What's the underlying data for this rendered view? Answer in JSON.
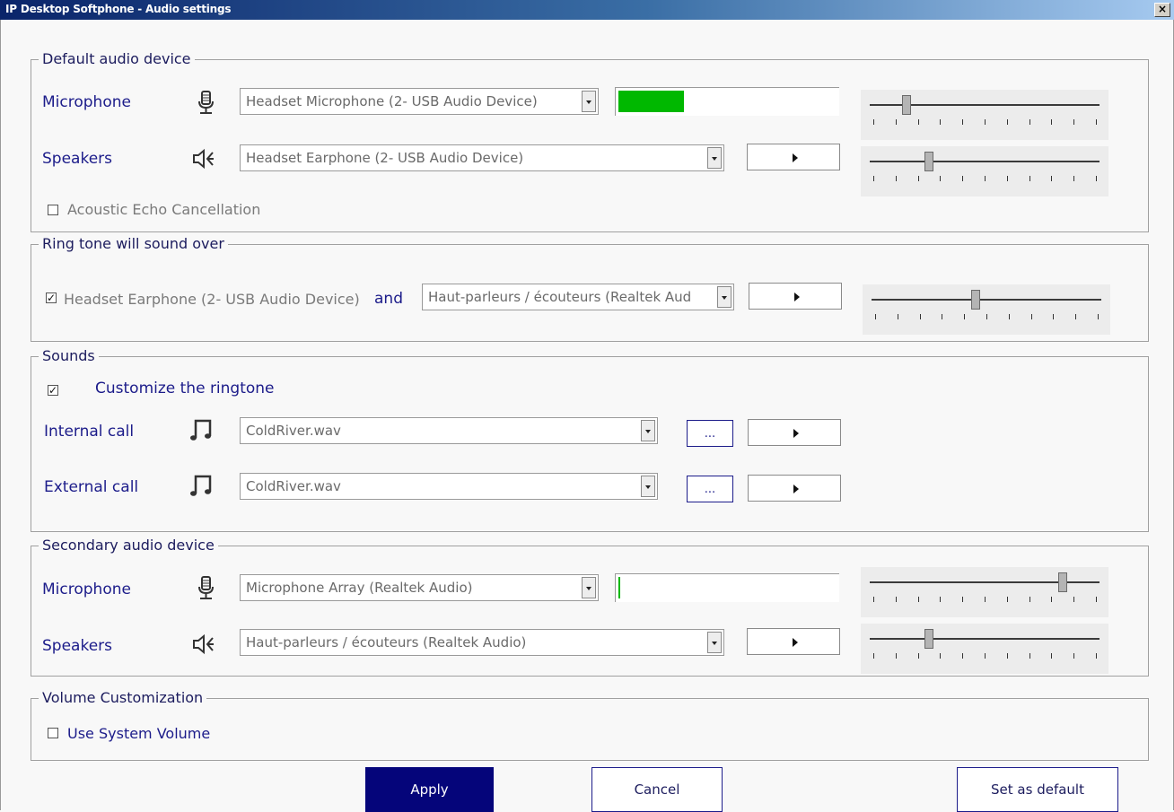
{
  "window": {
    "title": "IP Desktop Softphone - Audio settings",
    "close_label": "×"
  },
  "default_device": {
    "legend": "Default audio device",
    "microphone_label": "Microphone",
    "microphone_value": "Headset Microphone (2- USB Audio Device)",
    "microphone_level": 0.3,
    "microphone_volume": 0.15,
    "speakers_label": "Speakers",
    "speakers_value": "Headset Earphone (2- USB Audio Device)",
    "speakers_volume": 0.25,
    "echo_label": "Acoustic Echo Cancellation",
    "echo_checked": false
  },
  "ring_tone": {
    "legend": "Ring tone will sound over",
    "primary_checked": true,
    "primary_label": "Headset Earphone (2- USB Audio Device)",
    "and_label": "and",
    "secondary_value": "Haut-parleurs / écouteurs (Realtek Aud",
    "volume": 0.45
  },
  "sounds": {
    "legend": "Sounds",
    "customize_checked": true,
    "customize_label": "Customize the ringtone",
    "internal_label": "Internal call",
    "internal_value": "ColdRiver.wav",
    "external_label": "External call",
    "external_value": "ColdRiver.wav",
    "browse_label": "..."
  },
  "secondary_device": {
    "legend": "Secondary audio device",
    "microphone_label": "Microphone",
    "microphone_value": "Microphone Array (Realtek Audio)",
    "microphone_level": 0.01,
    "microphone_volume": 0.85,
    "speakers_label": "Speakers",
    "speakers_value": "Haut-parleurs / écouteurs (Realtek Audio)",
    "speakers_volume": 0.25
  },
  "volume_customization": {
    "legend": "Volume Customization",
    "system_label": "Use System Volume",
    "system_checked": false
  },
  "buttons": {
    "apply": "Apply",
    "cancel": "Cancel",
    "set_default": "Set as default"
  },
  "colors": {
    "title_start": "#0a246a",
    "label_blue": "#1c1c8a",
    "primary_button": "#05057a",
    "meter_green": "#00b800"
  },
  "icons": {
    "microphone": "microphone-icon",
    "speaker": "speaker-icon",
    "music": "music-note-icon",
    "play": "play-icon"
  }
}
